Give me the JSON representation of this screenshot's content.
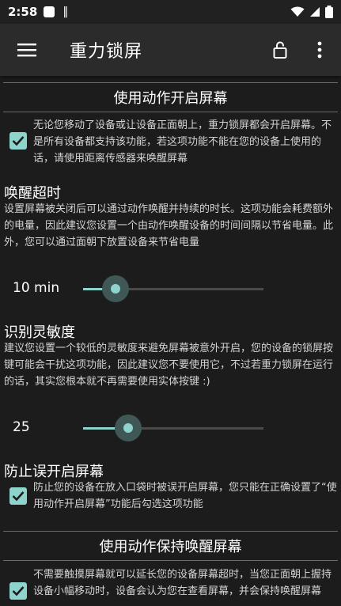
{
  "status_bar": {
    "time": "2:58",
    "signal_glyph": "‖"
  },
  "app_bar": {
    "title": "重力锁屏",
    "menu_icon": "menu-icon",
    "lock_icon": "unlock-icon",
    "more_icon": "more-vert-icon"
  },
  "accent_color": "#8fd3cd",
  "sections": {
    "activate": {
      "header": "使用动作开启屏幕",
      "checked": true,
      "description": "无论您移动了设备或让设备正面朝上，重力锁屏都会开启屏幕。不是所有设备都支持该功能，若这项功能不能在您的设备上使用的话，请使用距离传感器来唤醒屏幕"
    },
    "wake_timeout": {
      "title": "唤醒超时",
      "description": "设置屏幕被关闭后可以通过动作唤醒并持续的时长。这项功能会耗费额外的电量，因此建议您设置一个由动作唤醒设备的时间间隔以节省电量。此外，您可以通过面朝下放置设备来节省电量",
      "value_label": "10 min",
      "level": 0.18
    },
    "sensitivity": {
      "title": "识别灵敏度",
      "description": "建议您设置一个较低的灵敏度来避免屏幕被意外开启，您的设备的锁屏按键可能会干扰这项功能，因此建议您不要使用它，不过若重力锁屏在运行的话，其实您根本就不再需要使用实体按键 :)",
      "value_label": "25",
      "level": 0.25
    },
    "prevent": {
      "title": "防止误开启屏幕",
      "checked": true,
      "description": "防止您的设备在放入口袋时被误开启屏幕，您只能在正确设置了“使用动作开启屏幕”功能后勾选这项功能"
    },
    "keep_awake": {
      "header": "使用动作保持唤醒屏幕",
      "checked": true,
      "description": "不需要触摸屏幕就可以延长您的设备屏幕超时，当您正面朝上握持设备小幅移动时，设备会认为您在查看屏幕，并会保持唤醒屏幕"
    }
  }
}
